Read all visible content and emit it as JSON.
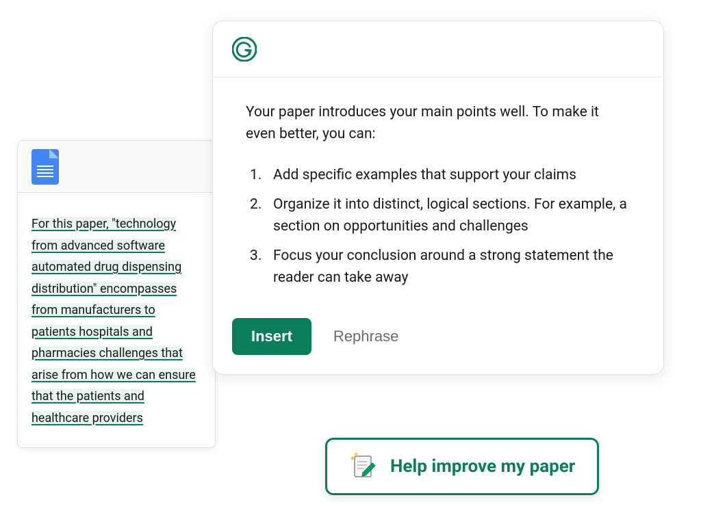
{
  "document": {
    "text": "For this paper, \"technology from advanced software automated drug dispensing distribution\" encompasses from manufacturers to patients hospitals and pharmacies challenges that arise from how we can ensure that the patients and healthcare providers"
  },
  "suggestion": {
    "intro": "Your paper introduces your main points well. To make it even better, you can:",
    "items": [
      "Add specific examples that support your claims",
      "Organize it into distinct, logical sections. For example, a section on opportunities and challenges",
      "Focus your conclusion around a strong statement the reader can take away"
    ],
    "insert_label": "Insert",
    "rephrase_label": "Rephrase"
  },
  "help_chip": {
    "label": "Help improve my paper"
  }
}
